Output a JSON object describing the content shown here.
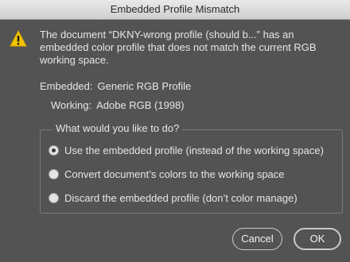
{
  "window": {
    "title": "Embedded Profile Mismatch"
  },
  "icon": {
    "name": "warning-icon",
    "color": "#f5c400"
  },
  "message": {
    "text": "The document “DKNY-wrong profile (should b...” has an embedded color profile that does not match the current RGB working space."
  },
  "profiles": {
    "embedded_label": "Embedded:",
    "embedded_value": "Generic RGB Profile",
    "working_label": "Working:",
    "working_value": "Adobe RGB (1998)"
  },
  "options": {
    "legend": "What would you like to do?",
    "items": [
      {
        "label": "Use the embedded profile (instead of the working space)",
        "selected": true
      },
      {
        "label": "Convert document’s colors to the working space",
        "selected": false
      },
      {
        "label": "Discard the embedded profile (don’t color manage)",
        "selected": false
      }
    ]
  },
  "buttons": {
    "cancel_label": "Cancel",
    "ok_label": "OK"
  }
}
